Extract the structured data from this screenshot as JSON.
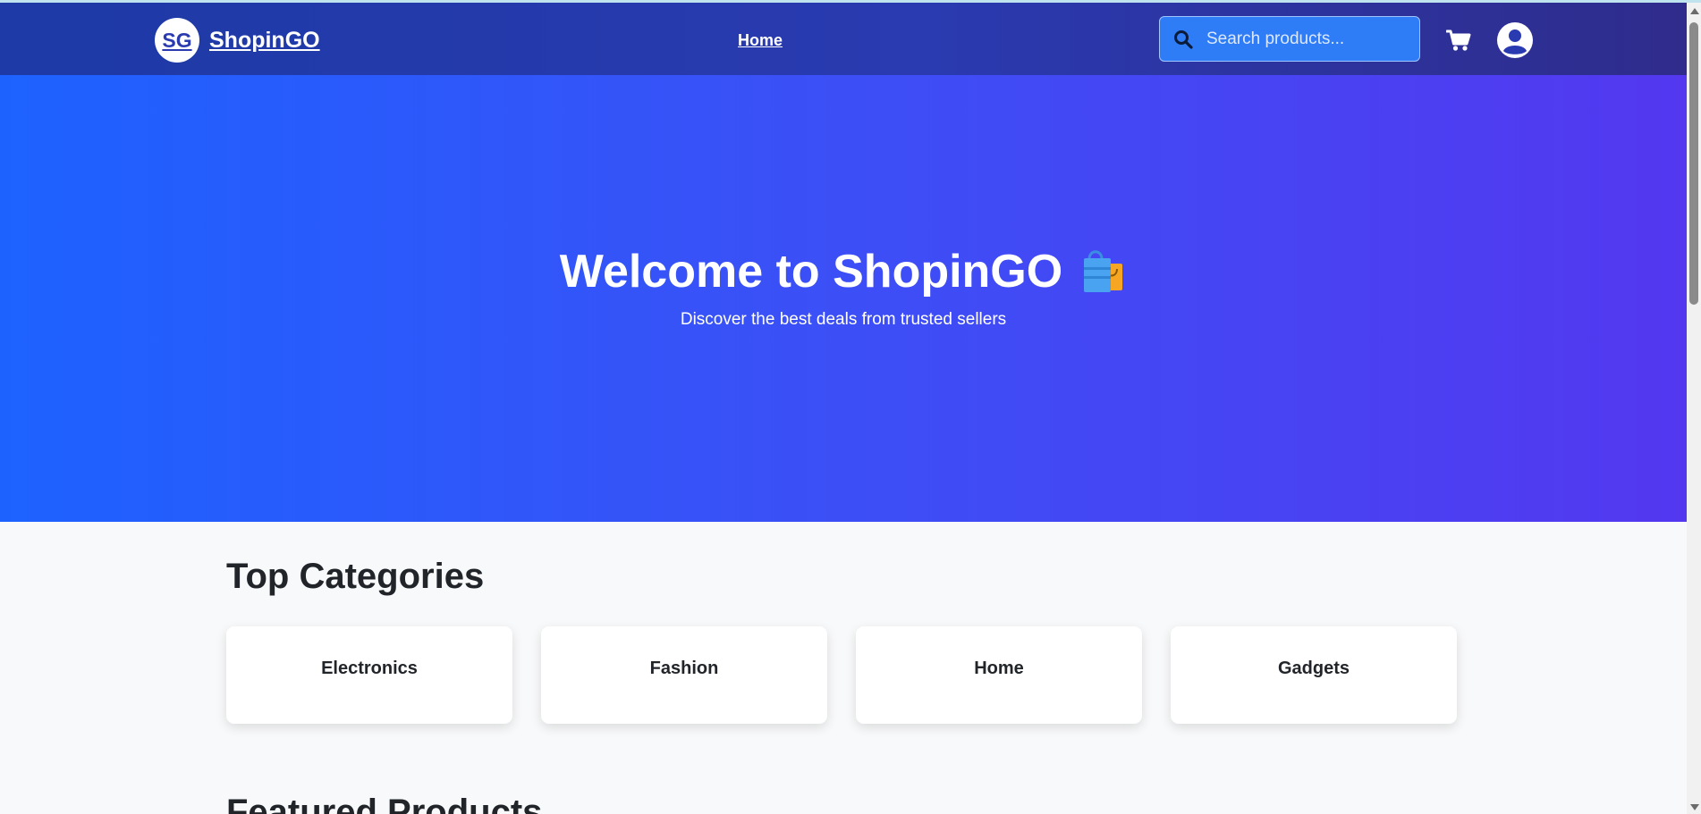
{
  "brand": {
    "logo_text": "SG",
    "name": "ShopinGO"
  },
  "nav": {
    "home_label": "Home"
  },
  "search": {
    "placeholder": "Search products..."
  },
  "icons": {
    "search": "search-icon",
    "cart": "cart-icon",
    "user": "user-circle-icon",
    "bag": "shopping-bags-icon"
  },
  "hero": {
    "title": "Welcome to ShopinGO",
    "subtitle": "Discover the best deals from trusted sellers"
  },
  "categories": {
    "heading": "Top Categories",
    "items": [
      {
        "label": "Electronics"
      },
      {
        "label": "Fashion"
      },
      {
        "label": "Home"
      },
      {
        "label": "Gadgets"
      }
    ]
  },
  "featured": {
    "heading": "Featured Products"
  },
  "colors": {
    "navbar": "#2a3ab0",
    "hero_start": "#1d62ff",
    "hero_end": "#5338f0",
    "search_bg": "#2f7df6",
    "page_bg": "#f8f9fa"
  }
}
